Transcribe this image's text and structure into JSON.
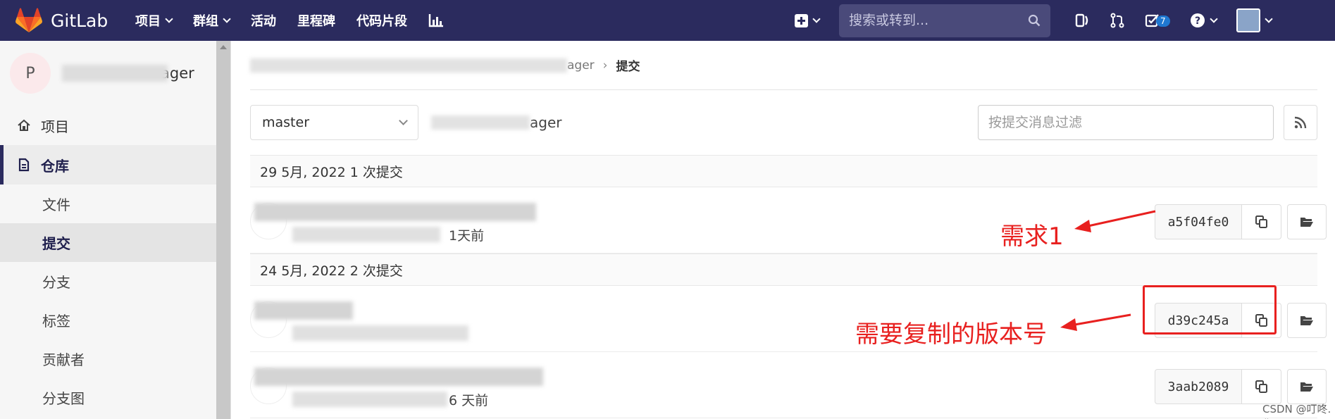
{
  "topnav": {
    "brand": "GitLab",
    "links": [
      {
        "label": "项目",
        "dropdown": true
      },
      {
        "label": "群组",
        "dropdown": true
      },
      {
        "label": "活动",
        "dropdown": false
      },
      {
        "label": "里程碑",
        "dropdown": false
      },
      {
        "label": "代码片段",
        "dropdown": false
      }
    ],
    "search_placeholder": "搜索或转到...",
    "todo_count": "7"
  },
  "sidebar": {
    "avatar_letter": "P",
    "project_name_suffix": "ager",
    "project_label": "项目",
    "repo_label": "仓库",
    "repo_items": [
      "文件",
      "提交",
      "分支",
      "标签",
      "贡献者",
      "分支图"
    ]
  },
  "breadcrumb": {
    "tail": "ager",
    "current": "提交"
  },
  "controls": {
    "branch": "master",
    "path_tail": "ager",
    "filter_placeholder": "按提交消息过滤"
  },
  "days": [
    {
      "header": "29 5月, 2022 1 次提交",
      "commits": [
        {
          "time": "1天前",
          "sha": "a5f04fe0"
        }
      ]
    },
    {
      "header": "24 5月, 2022 2 次提交",
      "commits": [
        {
          "time": "",
          "sha": "d39c245a"
        },
        {
          "time": "6 天前",
          "sha": "3aab2089"
        }
      ]
    }
  ],
  "annotations": {
    "label1": "需求1",
    "label2": "需要复制的版本号",
    "color": "#e8201f"
  },
  "watermark": "CSDN @叮咚.你"
}
